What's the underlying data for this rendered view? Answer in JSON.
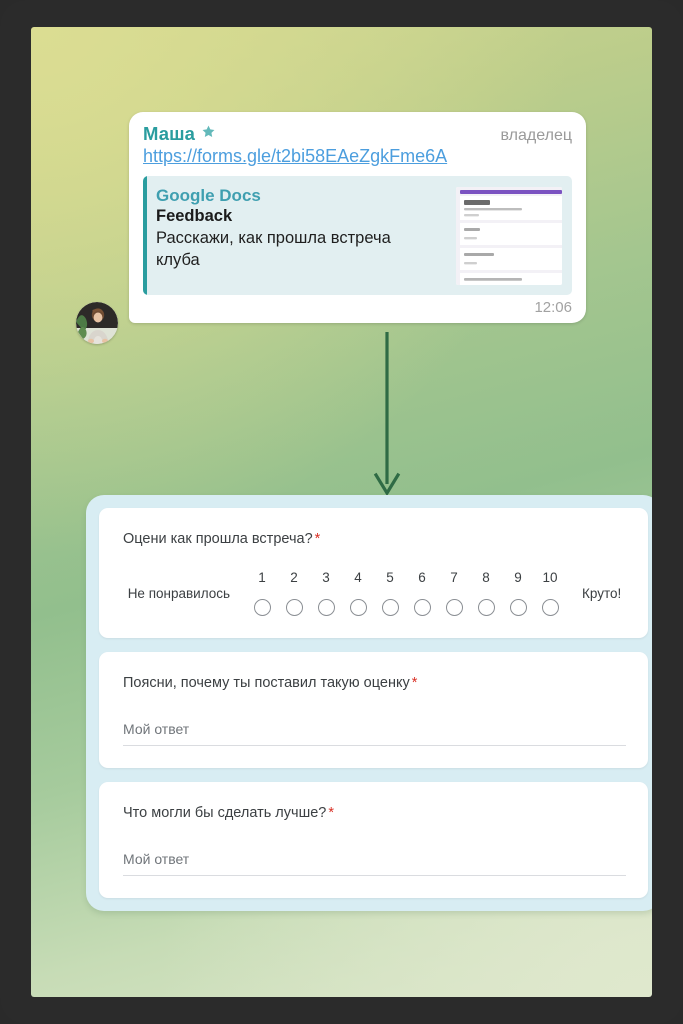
{
  "message": {
    "sender_name": "Маша",
    "sender_badge_icon": "star-icon",
    "owner_label": "владелец",
    "link_text": "https://forms.gle/t2bi58EAeZgkFme6A",
    "timestamp": "12:06",
    "preview": {
      "site_name": "Google Docs",
      "title": "Feedback",
      "description": "Расскажи, как прошла встреча клуба",
      "thumbnail_icon": "google-form-preview-thumbnail"
    }
  },
  "flow": {
    "arrow_icon": "down-arrow-icon",
    "arrow_color": "#2f6b45"
  },
  "form": {
    "questions": [
      {
        "title": "Оцени как прошла встреча?",
        "required_marker": "*",
        "type": "linear_scale",
        "scale_numbers": [
          "1",
          "2",
          "3",
          "4",
          "5",
          "6",
          "7",
          "8",
          "9",
          "10"
        ],
        "low_label": "Не понравилось",
        "high_label": "Круто!"
      },
      {
        "title": "Поясни, почему ты поставил такую оценку",
        "required_marker": "*",
        "type": "short_answer",
        "answer_placeholder": "Мой ответ"
      },
      {
        "title": "Что могли бы сделать лучше?",
        "required_marker": "*",
        "type": "short_answer",
        "answer_placeholder": "Мой ответ"
      }
    ]
  },
  "colors": {
    "accent_teal": "#2a9d9f",
    "link_blue": "#4c9ede",
    "required_red": "#d93025",
    "panel_blue": "#d8edf3",
    "arrow_green": "#2f6b45",
    "form_header_purple": "#7b53c1"
  }
}
